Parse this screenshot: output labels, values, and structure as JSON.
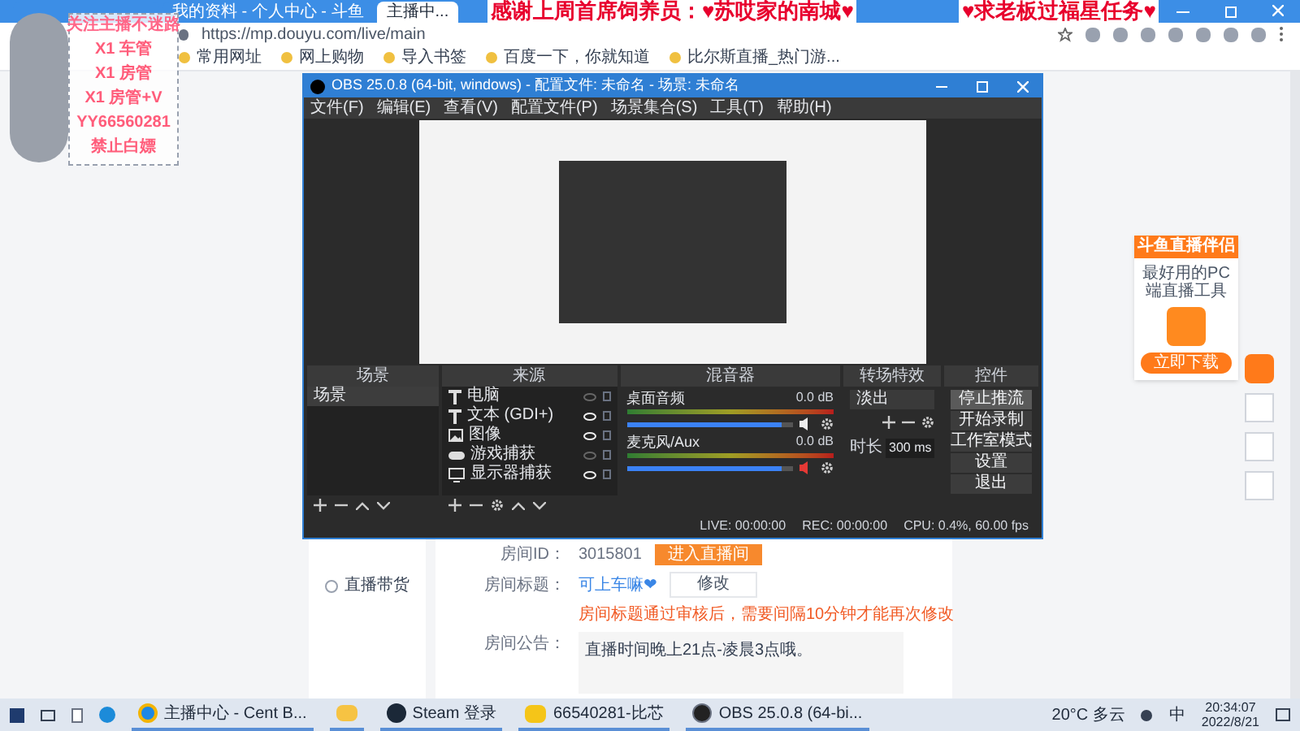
{
  "browser": {
    "tabs": [
      {
        "selected": false
      },
      {
        "label": "我的资料 - 个人中心 - 斗鱼",
        "selected": false
      },
      {
        "label": "主播中...",
        "selected": true
      }
    ],
    "address": "https://mp.douyu.com/live/main",
    "bookmarks": [
      "常用网址",
      "网上购物",
      "导入书签",
      "百度一下，你就知道",
      "比尔斯直播_热门游..."
    ]
  },
  "banner": [
    "感谢上周首席饲养员：♥苏哎家的南城♥",
    "♥求老板过福星任务♥"
  ],
  "overlay": {
    "title": "关注主播不迷路",
    "lines": [
      "X1 车管",
      "X1 房管",
      "X1 房管+V",
      "YY66560281",
      "禁止白嫖"
    ]
  },
  "page": {
    "sidebar_item": "直播带货",
    "room_id_label": "房间ID：",
    "room_id": "3015801",
    "enter_button": "进入直播间",
    "title_label": "房间标题：",
    "title_value": "可上车嘛❤",
    "edit_button": "修改",
    "title_note": "房间标题通过审核后，需要间隔10分钟才能再次修改",
    "notice_label": "房间公告：",
    "notice_value": "直播时间晚上21点-凌晨3点哦。"
  },
  "ad": {
    "title": "斗鱼直播伴侣",
    "subtitle": "最好用的PC端直播工具",
    "button": "立即下载"
  },
  "obs": {
    "title": "OBS 25.0.8 (64-bit, windows) - 配置文件: 未命名 - 场景: 未命名",
    "menu": [
      "文件(F)",
      "编辑(E)",
      "查看(V)",
      "配置文件(P)",
      "场景集合(S)",
      "工具(T)",
      "帮助(H)"
    ],
    "docks": [
      "场景",
      "来源",
      "混音器",
      "转场特效",
      "控件"
    ],
    "scenes": [
      {
        "name": "场景",
        "selected": true
      }
    ],
    "sources": [
      {
        "kind": "text",
        "name": "电脑",
        "visible": false
      },
      {
        "kind": "text",
        "name": "文本 (GDI+)",
        "visible": true
      },
      {
        "kind": "image",
        "name": "图像",
        "visible": true
      },
      {
        "kind": "game",
        "name": "游戏捕获",
        "visible": false
      },
      {
        "kind": "monitor",
        "name": "显示器捕获",
        "visible": true
      }
    ],
    "mixer": [
      {
        "name": "桌面音频",
        "reading": "0.0 dB",
        "level": 0.93,
        "muted": false
      },
      {
        "name": "麦克风/Aux",
        "reading": "0.0 dB",
        "level": 0.93,
        "muted": true
      }
    ],
    "transition": {
      "value": "淡出",
      "duration_label": "时长",
      "duration": "300 ms"
    },
    "controls": [
      {
        "label": "停止推流",
        "selected": true
      },
      {
        "label": "开始录制",
        "selected": false
      },
      {
        "label": "工作室模式",
        "selected": false
      },
      {
        "label": "设置",
        "selected": false
      },
      {
        "label": "退出",
        "selected": false
      }
    ],
    "status": [
      "LIVE: 00:00:00",
      "REC: 00:00:00",
      "CPU: 0.4%, 60.00 fps"
    ]
  },
  "taskbar": {
    "apps": [
      {
        "kind": "chrome",
        "label": "主播中心 - Cent B..."
      },
      {
        "kind": "folder"
      },
      {
        "kind": "steam",
        "label": "Steam 登录"
      },
      {
        "kind": "yellow",
        "label": "66540281-比芯"
      },
      {
        "kind": "obs",
        "label": "OBS 25.0.8 (64-bi..."
      }
    ],
    "weather": "20°C 多云",
    "ime": "中",
    "time": "20:34:07",
    "date": "2022/8/21"
  }
}
